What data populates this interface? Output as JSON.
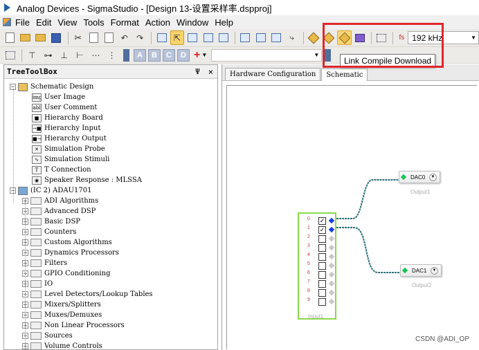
{
  "window": {
    "title": "Analog Devices - SigmaStudio - [Design 13-设置采样率.dspproj]"
  },
  "menu": {
    "items": [
      {
        "label": "File",
        "key": "F"
      },
      {
        "label": "Edit",
        "key": "E"
      },
      {
        "label": "View",
        "key": "V"
      },
      {
        "label": "Tools",
        "key": "T"
      },
      {
        "label": "Format",
        "key": "o"
      },
      {
        "label": "Action",
        "key": "A"
      },
      {
        "label": "Window",
        "key": "W"
      },
      {
        "label": "Help",
        "key": "H"
      }
    ]
  },
  "toolbar": {
    "sample_rate_label": "fs",
    "sample_rate_value": "192 kHz",
    "tooltip": "Link Compile Download",
    "letter_buttons": [
      "A",
      "B",
      "C",
      "D"
    ]
  },
  "treebox": {
    "title": "TreeToolBox",
    "pin": "Ψ",
    "close": "×",
    "schematic_root": "Schematic Design",
    "schematic_items": [
      {
        "label": "User Image",
        "icon": "user-image-icon",
        "glyph": "img"
      },
      {
        "label": "User Comment",
        "icon": "user-comment-icon",
        "glyph": "abl"
      },
      {
        "label": "Hierarchy Board",
        "icon": "hierarchy-board-icon",
        "glyph": "■"
      },
      {
        "label": "Hierarchy Input",
        "icon": "hierarchy-input-icon",
        "glyph": "→■"
      },
      {
        "label": "Hierarchy Output",
        "icon": "hierarchy-output-icon",
        "glyph": "■→"
      },
      {
        "label": "Simulation Probe",
        "icon": "simulation-probe-icon",
        "glyph": "✕"
      },
      {
        "label": "Simulation Stimuli",
        "icon": "simulation-stimuli-icon",
        "glyph": "∿"
      },
      {
        "label": "T Connection",
        "icon": "t-connection-icon",
        "glyph": "T"
      },
      {
        "label": "Speaker Response : MLSSA",
        "icon": "speaker-response-icon",
        "glyph": "◉"
      }
    ],
    "ic_root": "(IC 2) ADAU1701",
    "ic_items": [
      "ADI Algorithms",
      "Advanced DSP",
      "Basic DSP",
      "Counters",
      "Custom Algorithms",
      "Dynamics Processors",
      "Filters",
      "GPIO Conditioning",
      "IO",
      "Level Detectors/Lookup Tables",
      "Mixers/Splitters",
      "Muxes/Demuxes",
      "Non Linear Processors",
      "Sources",
      "Volume Controls"
    ]
  },
  "workspace": {
    "tabs": [
      "Hardware Configuration",
      "Schematic"
    ],
    "active_tab": "Schematic"
  },
  "schematic": {
    "input_block": {
      "label": "Input1",
      "channels": [
        {
          "num": "0",
          "checked": true,
          "connected": true
        },
        {
          "num": "1",
          "checked": true,
          "connected": true
        },
        {
          "num": "2",
          "checked": false,
          "connected": false
        },
        {
          "num": "3",
          "checked": false,
          "connected": false
        },
        {
          "num": "4",
          "checked": false,
          "connected": false
        },
        {
          "num": "5",
          "checked": false,
          "connected": false
        },
        {
          "num": "6",
          "checked": false,
          "connected": false
        },
        {
          "num": "7",
          "checked": false,
          "connected": false
        },
        {
          "num": "8",
          "checked": false,
          "connected": false
        },
        {
          "num": "9",
          "checked": false,
          "connected": false
        }
      ]
    },
    "dac0": {
      "name": "DAC0",
      "label": "Output1"
    },
    "dac1": {
      "name": "DAC1",
      "label": "Output2"
    }
  },
  "watermark": "CSDN @ADI_OP",
  "colors": {
    "highlight_box": "#e0262b",
    "input_border": "#8bd84a",
    "pin_connected": "#1a3fe0",
    "dac_pin": "#19c455",
    "wire": "#2a6f78"
  }
}
